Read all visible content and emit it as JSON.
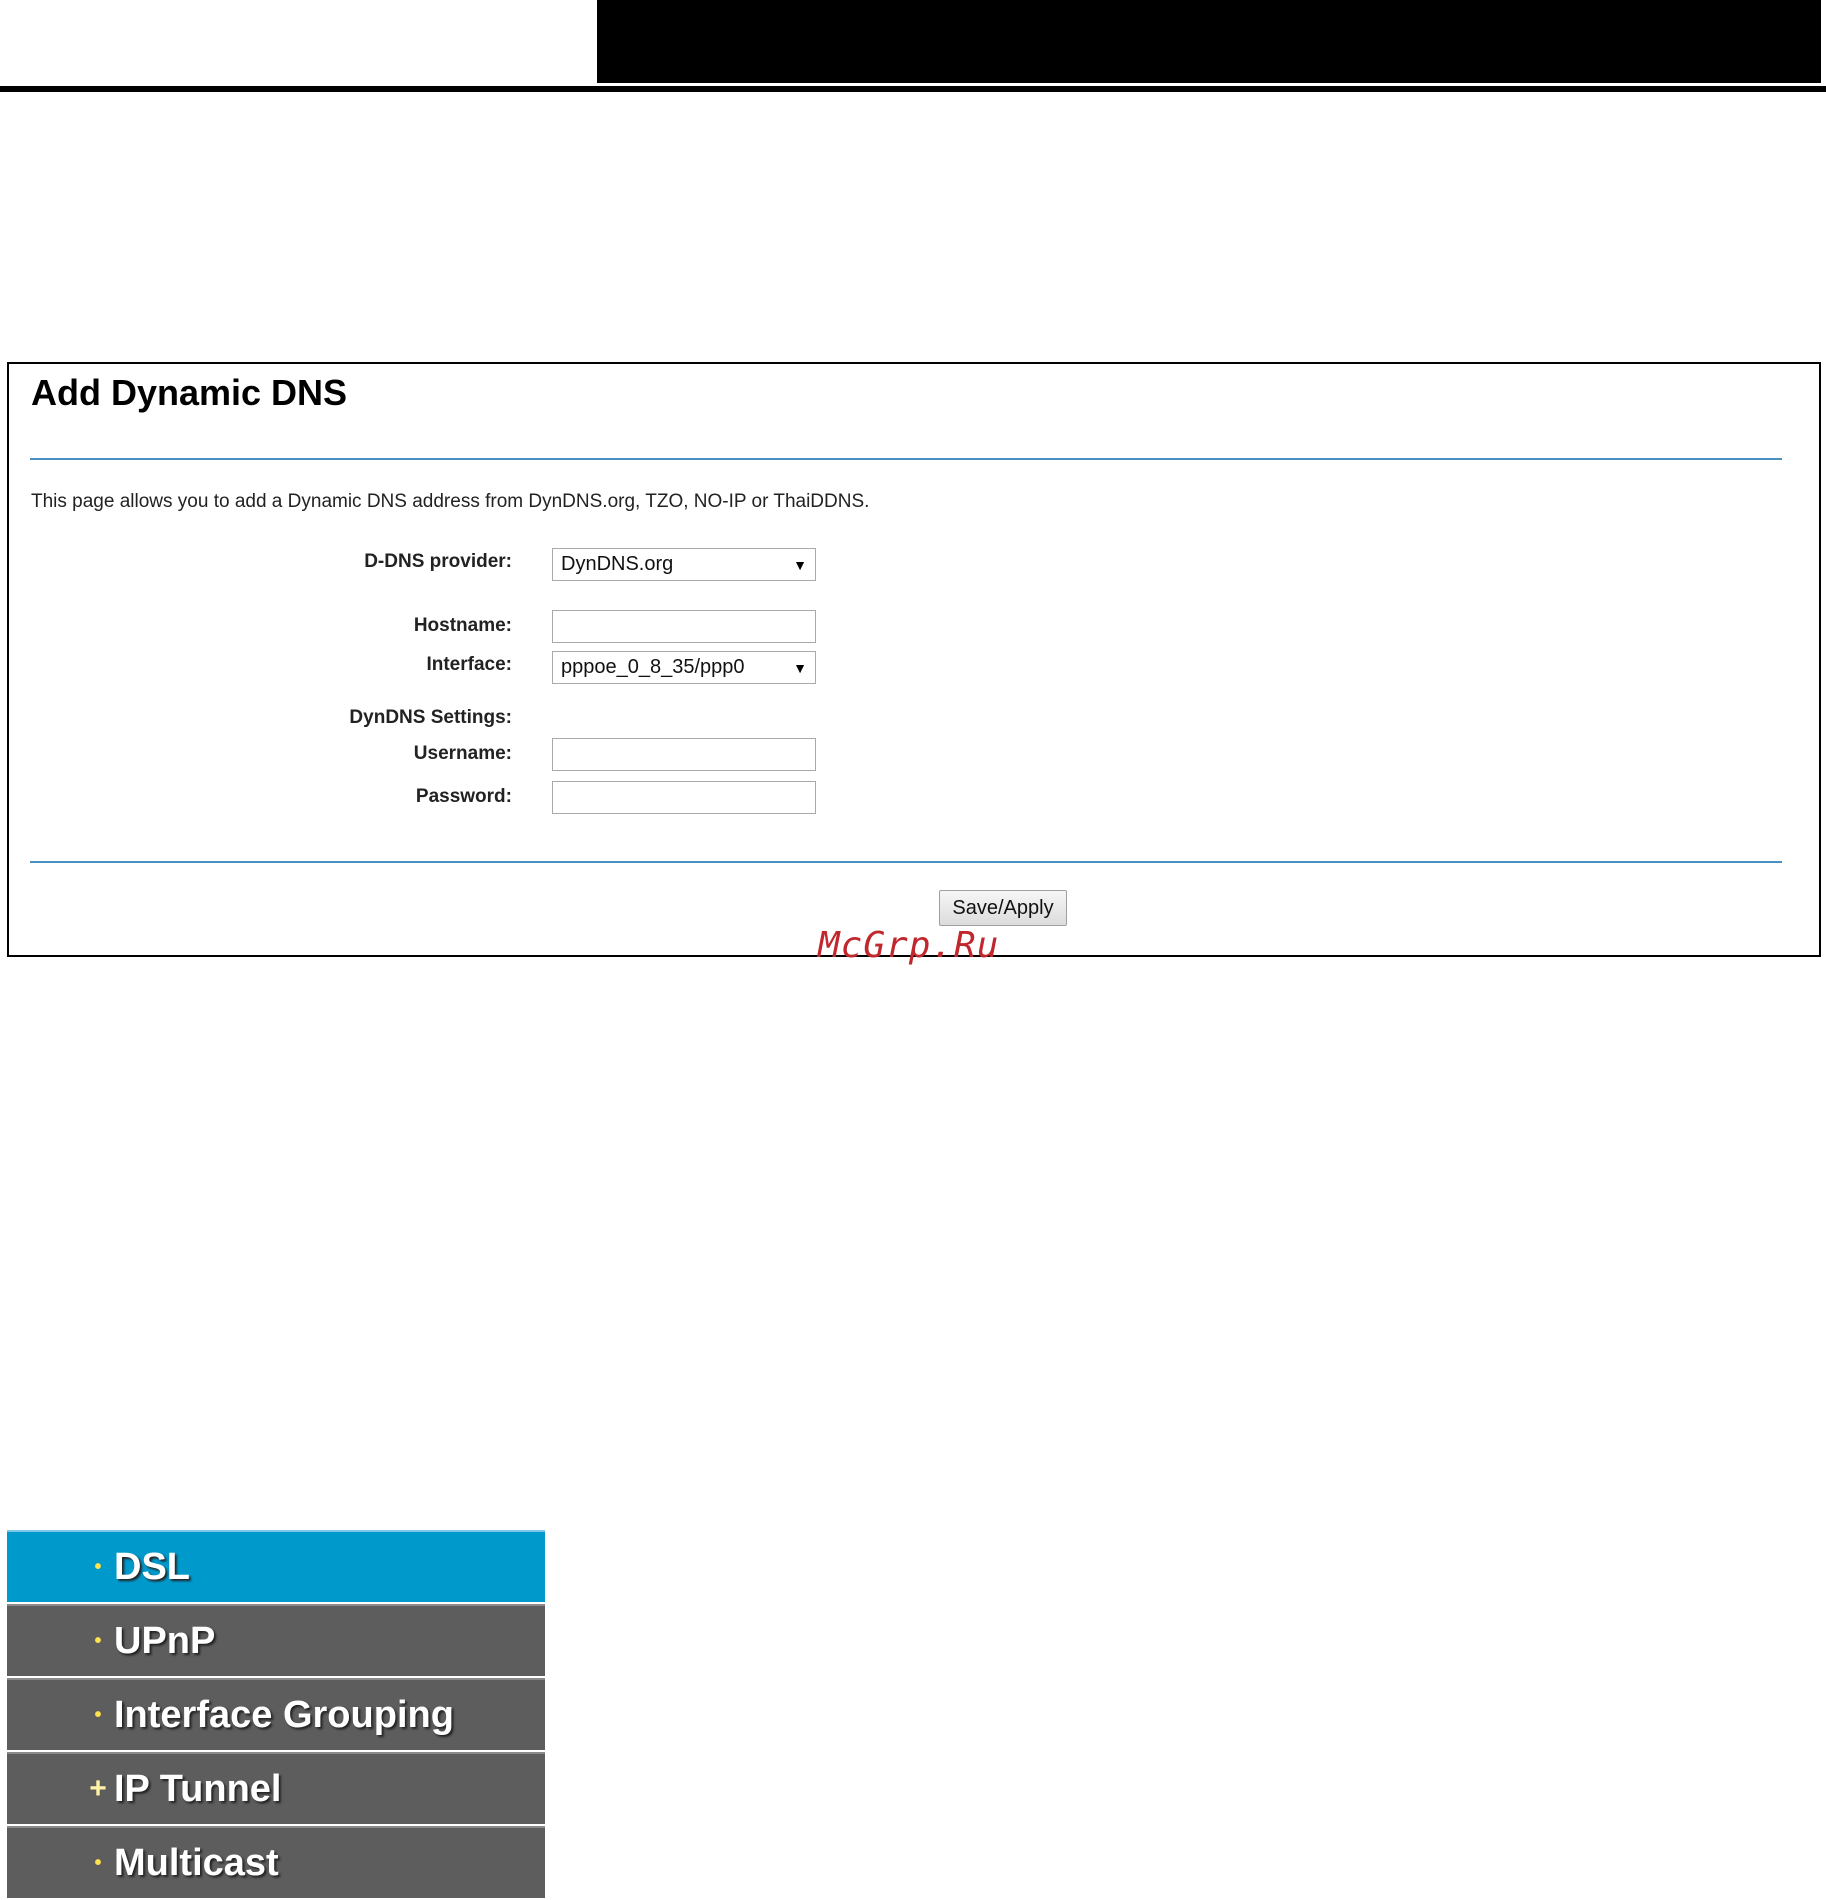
{
  "dialog": {
    "title": "Add Dynamic DNS",
    "description": "This page allows you to add a Dynamic DNS address from DynDNS.org, TZO, NO-IP or ThaiDDNS.",
    "provider_label": "D-DNS provider:",
    "provider_value": "DynDNS.org",
    "hostname_label": "Hostname:",
    "hostname_value": "",
    "interface_label": "Interface:",
    "interface_value": "pppoe_0_8_35/ppp0",
    "settings_label": "DynDNS Settings:",
    "username_label": "Username:",
    "username_value": "",
    "password_label": "Password:",
    "password_value": "",
    "save_label": "Save/Apply"
  },
  "watermark": "McGrp.Ru",
  "menu": {
    "items": [
      {
        "label": "DSL",
        "bullet": "•",
        "active": true
      },
      {
        "label": "UPnP",
        "bullet": "•",
        "active": false
      },
      {
        "label": "Interface Grouping",
        "bullet": "•",
        "active": false
      },
      {
        "label": "IP Tunnel",
        "bullet": "+",
        "active": false
      },
      {
        "label": "Multicast",
        "bullet": "•",
        "active": false
      }
    ]
  },
  "colors": {
    "accent_rule": "#4a90c2",
    "menu_active": "#0099cc",
    "menu_bg": "#5d5d5d",
    "watermark": "#c0282e"
  }
}
